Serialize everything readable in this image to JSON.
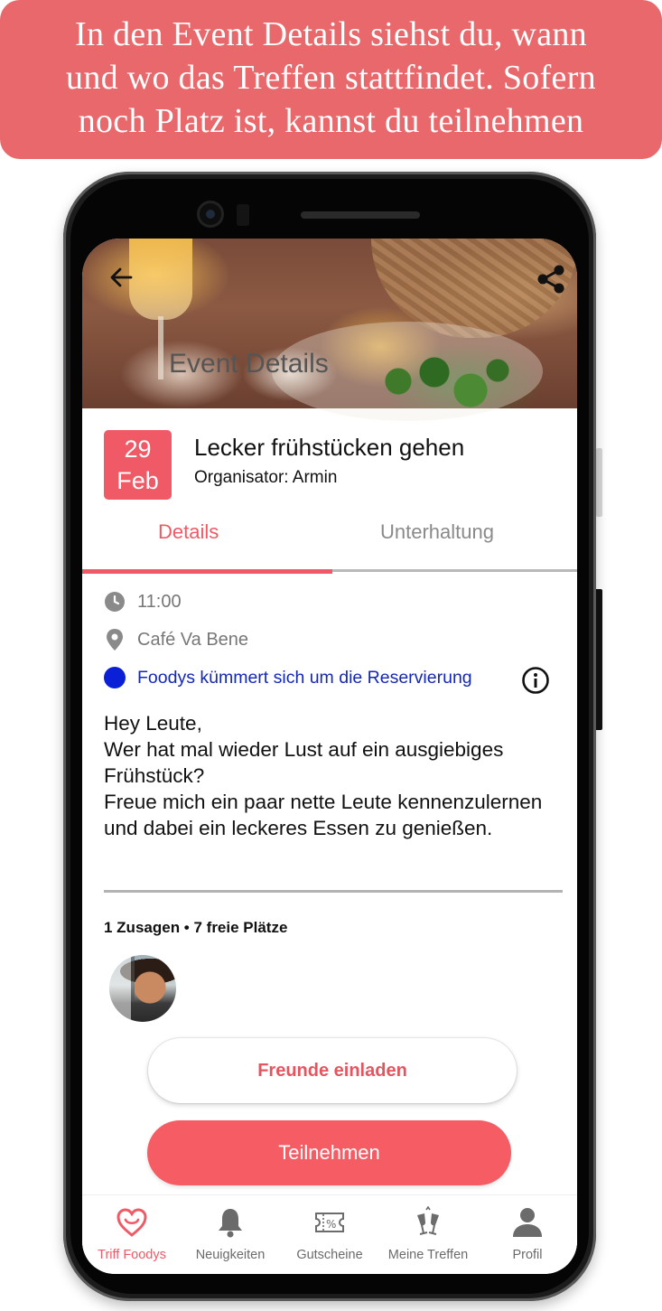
{
  "banner": {
    "line1": "In den Event Details siehst du, wann",
    "line2": "und wo das Treffen stattfindet. Sofern",
    "line3": "noch Platz ist, kannst du teilnehmen"
  },
  "header": {
    "title": "Event Details",
    "back_icon": "arrow-left-icon",
    "share_icon": "share-icon"
  },
  "event": {
    "day": "29",
    "month": "Feb",
    "title": "Lecker frühstücken gehen",
    "organizer": "Organisator: Armin"
  },
  "tabs": [
    {
      "label": "Details",
      "active": true
    },
    {
      "label": "Unterhaltung",
      "active": false
    }
  ],
  "info": {
    "time": "11:00",
    "place": "Café Va Bene",
    "reservation": "Foodys kümmert sich um die Reservierung"
  },
  "description": "Hey Leute,\nWer hat mal wieder Lust auf ein ausgiebiges Frühstück?\nFreue mich ein paar nette Leute kennenzulernen und dabei ein leckeres Essen zu genießen.",
  "participants": {
    "summary": "1 Zusagen • 7 freie Plätze"
  },
  "actions": {
    "invite": "Freunde einladen",
    "join": "Teilnehmen"
  },
  "nav": [
    {
      "label": "Triff Foodys",
      "icon": "heart-icon",
      "active": true
    },
    {
      "label": "Neuigkeiten",
      "icon": "bell-icon",
      "active": false
    },
    {
      "label": "Gutscheine",
      "icon": "coupon-icon",
      "active": false
    },
    {
      "label": "Meine Treffen",
      "icon": "cheers-icon",
      "active": false
    },
    {
      "label": "Profil",
      "icon": "person-icon",
      "active": false
    }
  ],
  "colors": {
    "accent": "#f05a66",
    "banner": "#e8686b",
    "link_blue": "#1428b8"
  }
}
